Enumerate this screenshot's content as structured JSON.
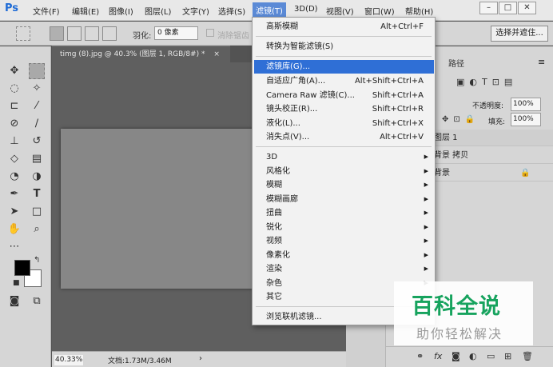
{
  "app": {
    "logo": "Ps"
  },
  "menubar": {
    "items": [
      "文件(F)",
      "编辑(E)",
      "图像(I)",
      "图层(L)",
      "文字(Y)",
      "选择(S)",
      "滤镜(T)",
      "3D(D)",
      "视图(V)",
      "窗口(W)",
      "帮助(H)"
    ],
    "window_buttons": [
      "–",
      "□",
      "✕"
    ]
  },
  "options": {
    "feather_label": "羽化:",
    "feather_value": "0 像素",
    "antialias": "消除锯齿",
    "select_mask": "选择并遮住..."
  },
  "document": {
    "tab_title": "timg (8).jpg @ 40.3% (图层 1, RGB/8#) *",
    "tab_close": "×",
    "zoom": "40.33%",
    "info": "文档:1.73M/3.46M",
    "status_arrow": "›"
  },
  "panel": {
    "path_tab": "路径",
    "opacity_label": "不透明度:",
    "opacity_value": "100%",
    "fill_label": "填充:",
    "fill_value": "100%",
    "layers": [
      "图层 1",
      "背景 拷贝",
      "背景"
    ],
    "lock_icon": "🔒"
  },
  "filter_menu": {
    "items": [
      {
        "label": "高斯模糊",
        "shortcut": "Alt+Ctrl+F"
      },
      {
        "label": "转换为智能滤镜(S)",
        "shortcut": ""
      },
      {
        "label": "滤镜库(G)...",
        "shortcut": ""
      },
      {
        "label": "自适应广角(A)...",
        "shortcut": "Alt+Shift+Ctrl+A"
      },
      {
        "label": "Camera Raw 滤镜(C)...",
        "shortcut": "Shift+Ctrl+A"
      },
      {
        "label": "镜头校正(R)...",
        "shortcut": "Shift+Ctrl+R"
      },
      {
        "label": "液化(L)...",
        "shortcut": "Shift+Ctrl+X"
      },
      {
        "label": "消失点(V)...",
        "shortcut": "Alt+Ctrl+V"
      },
      {
        "label": "3D",
        "shortcut": ""
      },
      {
        "label": "风格化",
        "shortcut": ""
      },
      {
        "label": "模糊",
        "shortcut": ""
      },
      {
        "label": "模糊画廊",
        "shortcut": ""
      },
      {
        "label": "扭曲",
        "shortcut": ""
      },
      {
        "label": "锐化",
        "shortcut": ""
      },
      {
        "label": "视频",
        "shortcut": ""
      },
      {
        "label": "像素化",
        "shortcut": ""
      },
      {
        "label": "渲染",
        "shortcut": ""
      },
      {
        "label": "杂色",
        "shortcut": ""
      },
      {
        "label": "其它",
        "shortcut": ""
      },
      {
        "label": "浏览联机滤镜...",
        "shortcut": ""
      }
    ],
    "submenu_arrow": "▶"
  },
  "watermark": {
    "title": "百科全说",
    "subtitle": "助你轻松解决"
  },
  "colors": {
    "accent": "#2f6fd6",
    "foreground": "#000000",
    "background": "#ffffff",
    "watermark": "#17a35e"
  }
}
